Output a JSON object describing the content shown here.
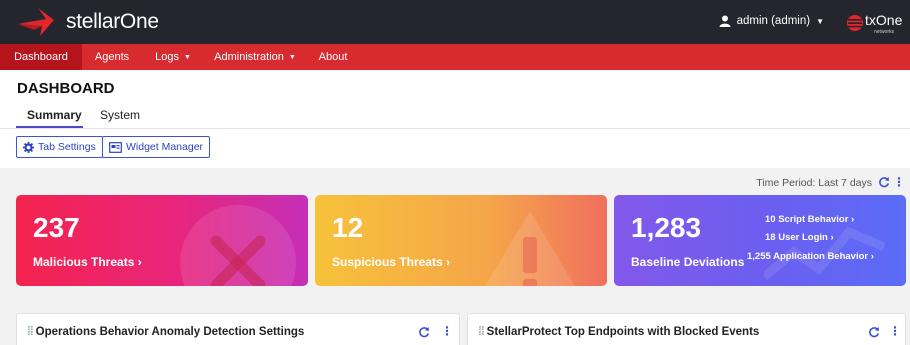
{
  "app": {
    "name": "stellarOne",
    "user_label": "admin (admin)",
    "vendor_name": "txOne",
    "vendor_tagline": "networks"
  },
  "nav": {
    "items": [
      {
        "label": "Dashboard",
        "active": true,
        "has_menu": false
      },
      {
        "label": "Agents",
        "active": false,
        "has_menu": false
      },
      {
        "label": "Logs",
        "active": false,
        "has_menu": true
      },
      {
        "label": "Administration",
        "active": false,
        "has_menu": true
      },
      {
        "label": "About",
        "active": false,
        "has_menu": false
      }
    ]
  },
  "page": {
    "title": "DASHBOARD",
    "tabs": [
      {
        "label": "Summary",
        "active": true
      },
      {
        "label": "System",
        "active": false
      }
    ],
    "buttons": {
      "tab_settings": "Tab Settings",
      "widget_manager": "Widget Manager"
    },
    "time_period": "Time Period: Last 7 days"
  },
  "cards": {
    "malicious": {
      "value": "237",
      "label": "Malicious Threats"
    },
    "suspicious": {
      "value": "12",
      "label": "Suspicious Threats"
    },
    "baseline": {
      "value": "1,283",
      "label": "Baseline Deviations",
      "breakdown": [
        {
          "count": "10",
          "label": "Script Behavior"
        },
        {
          "count": "18",
          "label": "User Login"
        },
        {
          "count": "1,255",
          "label": "Application Behavior"
        }
      ]
    }
  },
  "panels": {
    "left_title": "Operations Behavior Anomaly Detection Settings",
    "right_title": "StellarProtect Top Endpoints with Blocked Events"
  },
  "colors": {
    "topbar": "#25252e",
    "navbar": "#d72b30",
    "nav_active": "#b5141c",
    "accent_blue": "#3c55c8",
    "tab_underline": "#5046c9"
  }
}
